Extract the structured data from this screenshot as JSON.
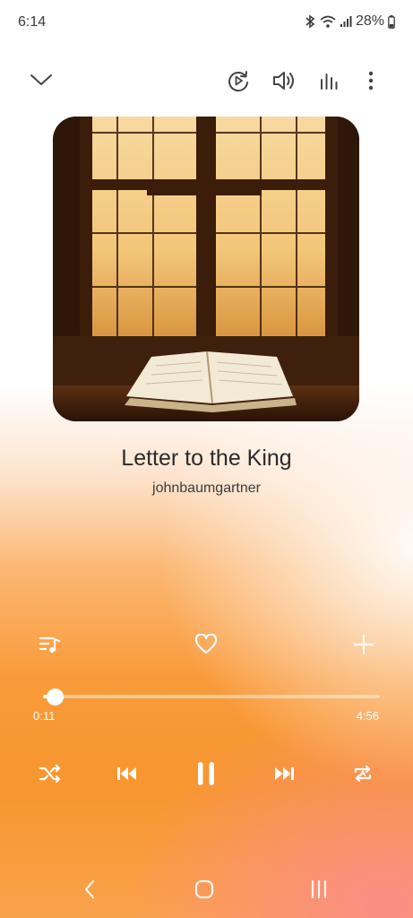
{
  "status_bar": {
    "time": "6:14",
    "battery": "28%"
  },
  "track": {
    "title": "Letter to the King",
    "artist": "johnbaumgartner"
  },
  "player": {
    "elapsed": "0:11",
    "duration": "4:56",
    "progress_fraction": 0.037
  },
  "icons": {
    "collapse": "chevron-down-icon",
    "cast": "playback-switch-icon",
    "volume": "volume-icon",
    "equalizer": "equalizer-icon",
    "more": "more-vertical-icon",
    "playlist": "playlist-icon",
    "favorite": "heart-icon",
    "add": "plus-icon",
    "shuffle": "shuffle-icon",
    "previous": "previous-icon",
    "pause": "pause-icon",
    "next": "next-icon",
    "repeat": "repeat-icon"
  },
  "colors": {
    "accent_gradient_start": "#ffffff",
    "accent_gradient_mid": "#f8962f",
    "accent_gradient_end": "#fb8d86"
  }
}
